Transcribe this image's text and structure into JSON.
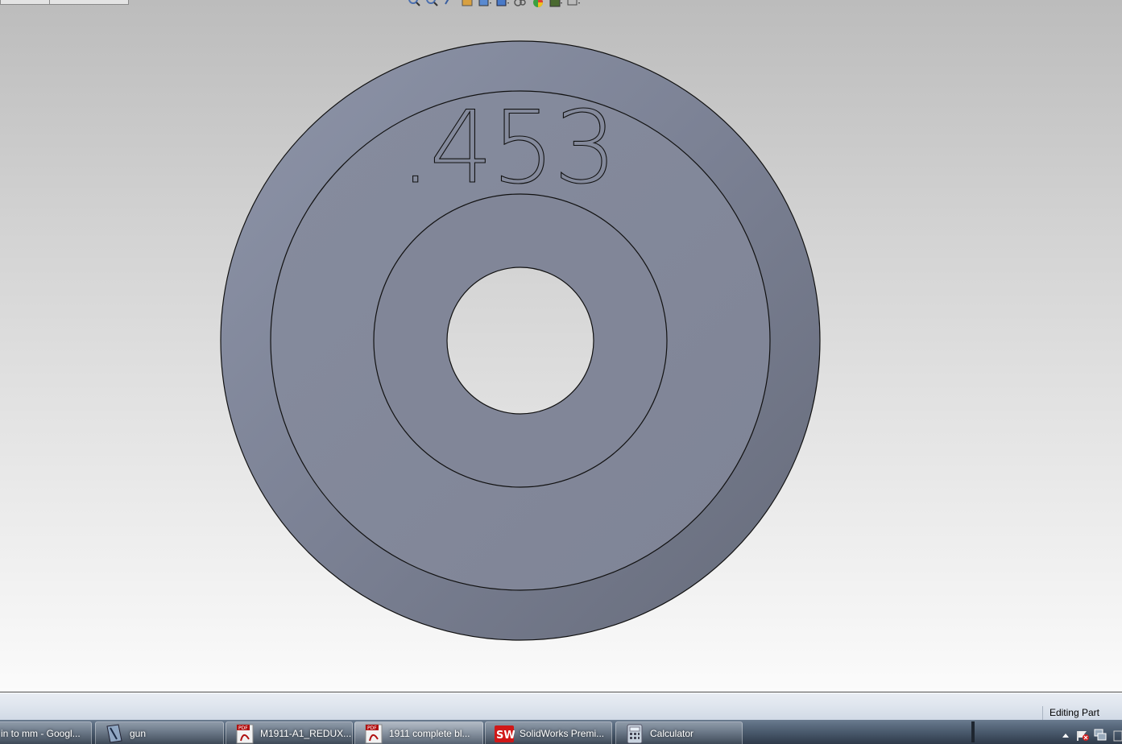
{
  "viewport": {
    "engraving_text": ".453",
    "colors": {
      "face_outer": "#7e8598",
      "face_inner": "#838899",
      "edge": "#101010",
      "hole": "#dadada"
    }
  },
  "heads_up_toolbar": {
    "icons": [
      "zoom-to-fit-icon",
      "zoom-area-icon",
      "previous-view-icon",
      "section-view-icon",
      "view-orientation-icon",
      "display-style-icon",
      "hide-show-items-icon",
      "edit-appearance-icon",
      "apply-scene-icon",
      "view-settings-icon"
    ]
  },
  "status_bar": {
    "text": "Editing Part"
  },
  "taskbar": {
    "items": [
      {
        "label": "in to mm - Googl...",
        "icon": "chrome-icon"
      },
      {
        "label": "gun",
        "icon": "document-icon"
      },
      {
        "label": "M1911-A1_REDUX...",
        "icon": "pdf-icon"
      },
      {
        "label": "1911 complete bl...",
        "icon": "pdf-icon"
      },
      {
        "label": "SolidWorks Premi...",
        "icon": "solidworks-icon"
      },
      {
        "label": "Calculator",
        "icon": "calculator-icon"
      }
    ],
    "tray_icons": [
      "show-hidden-icons-icon",
      "action-center-icon",
      "network-icon",
      "clock-area"
    ]
  }
}
